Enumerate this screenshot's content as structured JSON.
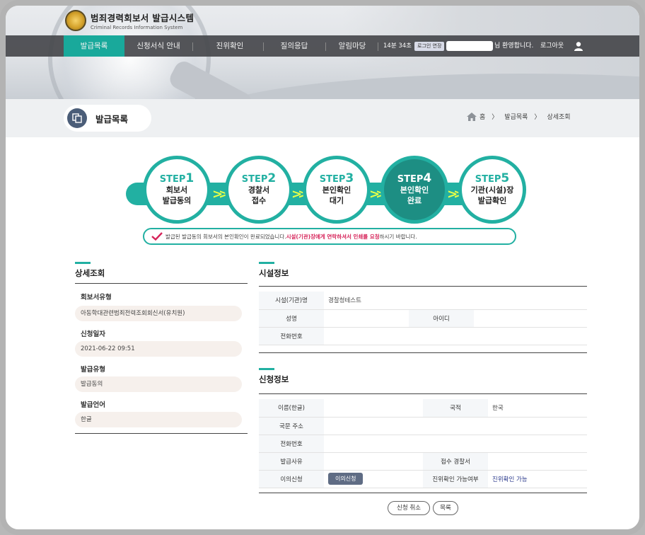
{
  "header": {
    "title": "범죄경력회보서 발급시스템",
    "subtitle": "Criminal Records Information System"
  },
  "nav": {
    "items": [
      "발급목록",
      "신청서식 안내",
      "진위확인",
      "질의응답",
      "알림마당"
    ],
    "timer": "14분 34초",
    "extend": "로그인 연장",
    "greeting": "님 환영합니다.",
    "logout": "로그아웃"
  },
  "page": {
    "title": "발급목록",
    "breadcrumb": [
      "홈",
      "발급목록",
      "상세조회"
    ]
  },
  "steps": [
    {
      "step": "STEP",
      "num": "1",
      "l1": "회보서",
      "l2": "발급동의",
      "active": false
    },
    {
      "step": "STEP",
      "num": "2",
      "l1": "경찰서",
      "l2": "접수",
      "active": false
    },
    {
      "step": "STEP",
      "num": "3",
      "l1": "본인확인",
      "l2": "대기",
      "active": false
    },
    {
      "step": "STEP",
      "num": "4",
      "l1": "본인확인",
      "l2": "완료",
      "active": true
    },
    {
      "step": "STEP",
      "num": "5",
      "l1": "기관(시설)장",
      "l2": "발급확인",
      "active": false
    }
  ],
  "notice": {
    "pre": "발급된 발급동의 회보서의 본인확인이 완료되었습니다.",
    "highlight": "시설(기관)장에게 연락하셔서 인쇄를 요청",
    "post": "하시기 바랍니다."
  },
  "detail": {
    "heading": "상세조회",
    "fields": [
      {
        "label": "회보서유형",
        "value": "아동학대관련범죄전력조회회신서(유치원)"
      },
      {
        "label": "신청일자",
        "value": "2021-06-22 09:51"
      },
      {
        "label": "발급유형",
        "value": "발급동의"
      },
      {
        "label": "발급언어",
        "value": "한글"
      }
    ]
  },
  "facility": {
    "heading": "시설정보",
    "name_label": "시설(기관)명",
    "name_value": "경찰청테스트",
    "person_label": "성명",
    "person_value": "",
    "id_label": "아이디",
    "id_value": "",
    "phone_label": "전화번호",
    "phone_value": ""
  },
  "application": {
    "heading": "신청정보",
    "name_label": "이름(한글)",
    "name_value": "",
    "nation_label": "국적",
    "nation_value": "한국",
    "address_label": "국문 주소",
    "address_value": "",
    "phone_label": "전화번호",
    "phone_value": "",
    "reason_label": "발급사유",
    "reason_value": "",
    "station_label": "접수 경찰서",
    "station_value": "",
    "objection_label": "이의신청",
    "objection_button": "이의신청",
    "verify_label": "진위확인 가능여부",
    "verify_value": "진위확인 가능"
  },
  "actions": {
    "cancel": "신청 취소",
    "list": "목록"
  },
  "colors": {
    "accent": "#22b0a2",
    "nav_bg": "#46484c",
    "highlight_red": "#d6245a"
  }
}
